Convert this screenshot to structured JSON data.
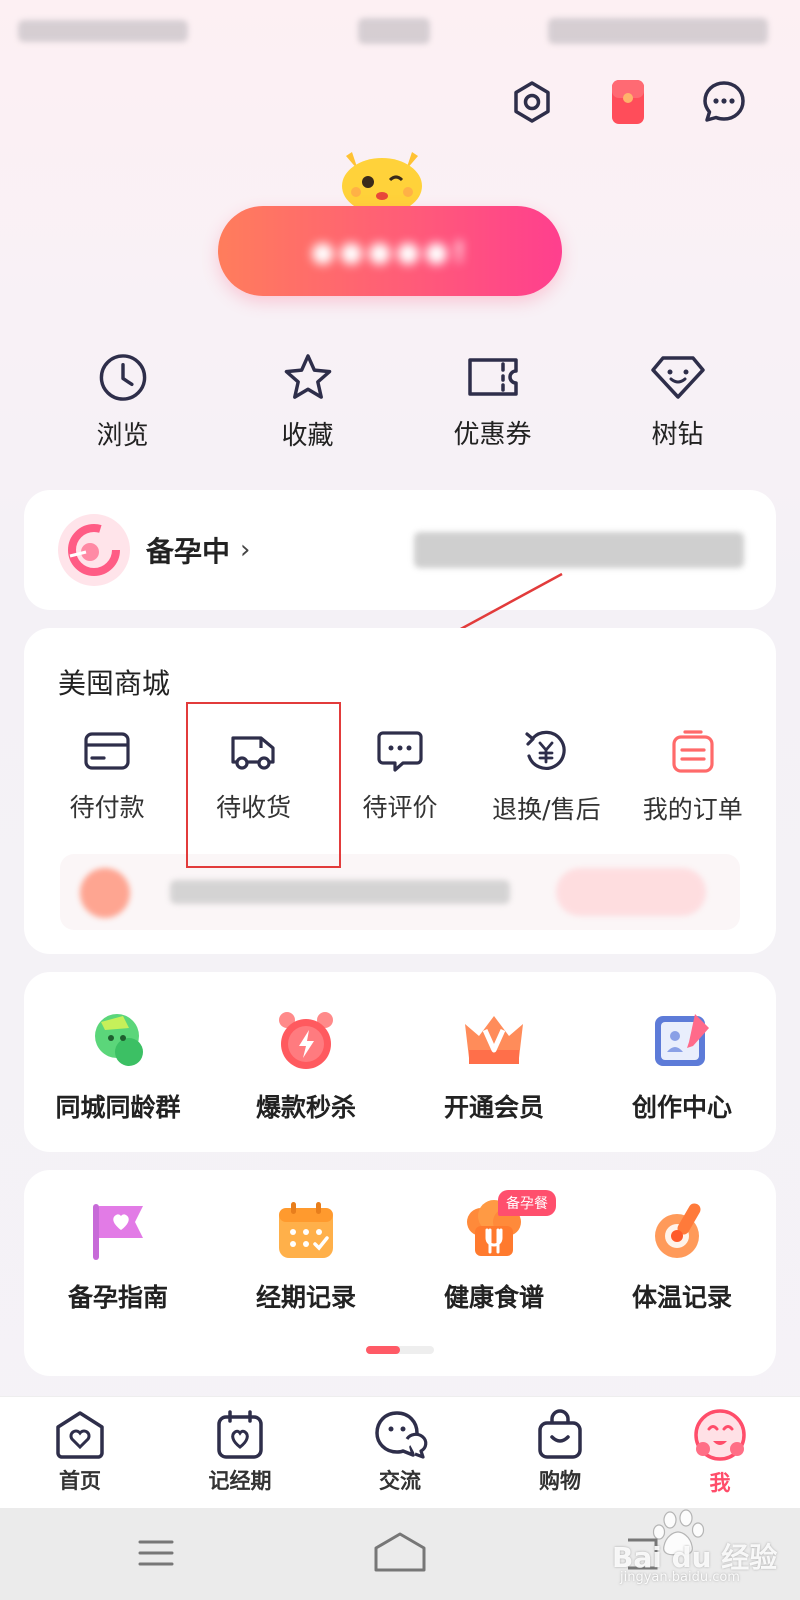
{
  "header": {
    "icons": [
      "settings-icon",
      "red-packet-icon",
      "message-icon"
    ]
  },
  "quick": {
    "items": [
      {
        "label": "浏览",
        "icon": "clock-icon"
      },
      {
        "label": "收藏",
        "icon": "star-icon"
      },
      {
        "label": "优惠券",
        "icon": "coupon-icon"
      },
      {
        "label": "树钻",
        "icon": "diamond-icon"
      }
    ]
  },
  "status": {
    "label": "备孕中",
    "arrow": "›"
  },
  "mall": {
    "title": "美囤商城",
    "orders": [
      {
        "label": "待付款",
        "icon": "card-icon"
      },
      {
        "label": "待收货",
        "icon": "truck-icon"
      },
      {
        "label": "待评价",
        "icon": "comment-icon"
      },
      {
        "label": "退换/售后",
        "icon": "refund-icon"
      },
      {
        "label": "我的订单",
        "icon": "order-list-icon"
      }
    ]
  },
  "features": {
    "row1": [
      {
        "label": "同城同龄群",
        "icon": "group-chat-icon"
      },
      {
        "label": "爆款秒杀",
        "icon": "alarm-flash-icon"
      },
      {
        "label": "开通会员",
        "icon": "crown-icon"
      },
      {
        "label": "创作中心",
        "icon": "create-icon"
      }
    ],
    "row2": [
      {
        "label": "备孕指南",
        "icon": "guide-flag-icon"
      },
      {
        "label": "经期记录",
        "icon": "calendar-icon"
      },
      {
        "label": "健康食谱",
        "icon": "chef-icon",
        "badge": "备孕餐"
      },
      {
        "label": "体温记录",
        "icon": "thermometer-icon"
      }
    ]
  },
  "nav": {
    "items": [
      {
        "label": "首页",
        "icon": "home-icon"
      },
      {
        "label": "记经期",
        "icon": "period-calendar-icon"
      },
      {
        "label": "交流",
        "icon": "chat-icon"
      },
      {
        "label": "购物",
        "icon": "bag-icon"
      },
      {
        "label": "我",
        "icon": "me-avatar-icon"
      }
    ],
    "active_color": "#ff4d6a"
  },
  "watermark": {
    "brand": "Bai du 经验",
    "url": "jingyan.baidu.com"
  },
  "colors": {
    "accent": "#ff4f6d",
    "highlight_box": "#e23b3b"
  }
}
